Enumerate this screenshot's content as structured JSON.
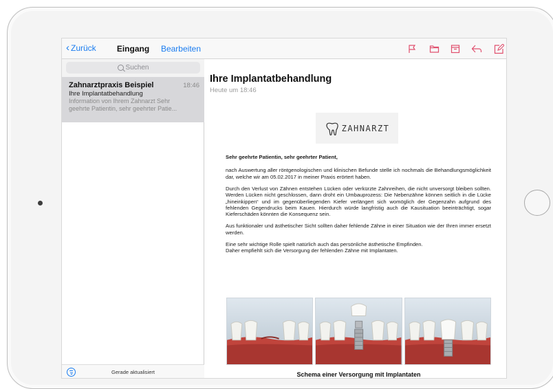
{
  "sidebar": {
    "back_label": "Zurück",
    "title": "Eingang",
    "edit_label": "Bearbeiten",
    "search_placeholder": "Suchen",
    "messages": [
      {
        "sender": "Zahnarztpraxis Beispiel",
        "time": "18:46",
        "subject": "Ihre Implantatbehandlung",
        "preview_line1": "Information von Ihrem Zahnarzt Sehr",
        "preview_line2": "geehrte Patientin, sehr geehrter Patie..."
      }
    ],
    "status": "Gerade aktualisiert"
  },
  "toolbar": {
    "icons": [
      "flag-icon",
      "folder-icon",
      "archive-icon",
      "reply-icon",
      "compose-icon"
    ]
  },
  "mail": {
    "title": "Ihre Implantatbehandlung",
    "date": "Heute um 18:46",
    "logo_text": "ZAHNARZT",
    "greeting": "Sehr geehrte Patientin, sehr geehrter Patient,",
    "paragraphs": [
      "nach Auswertung aller röntgenologischen und klinischen Befunde stelle ich nochmals die Behandlungsmöglichkeit dar, welche wir am 05.02.2017 in meiner Praxis erörtert haben.",
      "Durch den Verlust von Zähnen entstehen Lücken oder verkürzte Zahnreihen, die nicht unversorgt bleiben sollten. Werden Lücken nicht geschlossen, dann droht ein Umbauprozess: Die Nebenzähne können seitlich in die Lücke „hineinkippen“ und im gegenüberliegenden Kiefer verlängert sich womöglich der Gegenzahn aufgrund des fehlenden Gegendrucks beim Kauen. Hierdurch würde langfristig auch die Kausituation beeinträchtigt, sogar Kieferschäden könnten die Konsequenz sein.",
      "Aus funktionaler und ästhetischer Sicht sollten daher fehlende Zähne in einer Situation wie der Ihren immer ersetzt werden.",
      "Eine sehr wichtige Rolle spielt natürlich auch das persönliche ästhetische Empfinden.",
      "Daher empfiehlt sich die Versorgung der fehlenden Zähne mit Implantaten."
    ],
    "caption": "Schema einer Versorgung mit Implantaten"
  },
  "colors": {
    "accent": "#1a7cf0",
    "toolbar_icon": "#e0506e",
    "selected_row": "#d7d7da",
    "gum": "#c0443c"
  }
}
